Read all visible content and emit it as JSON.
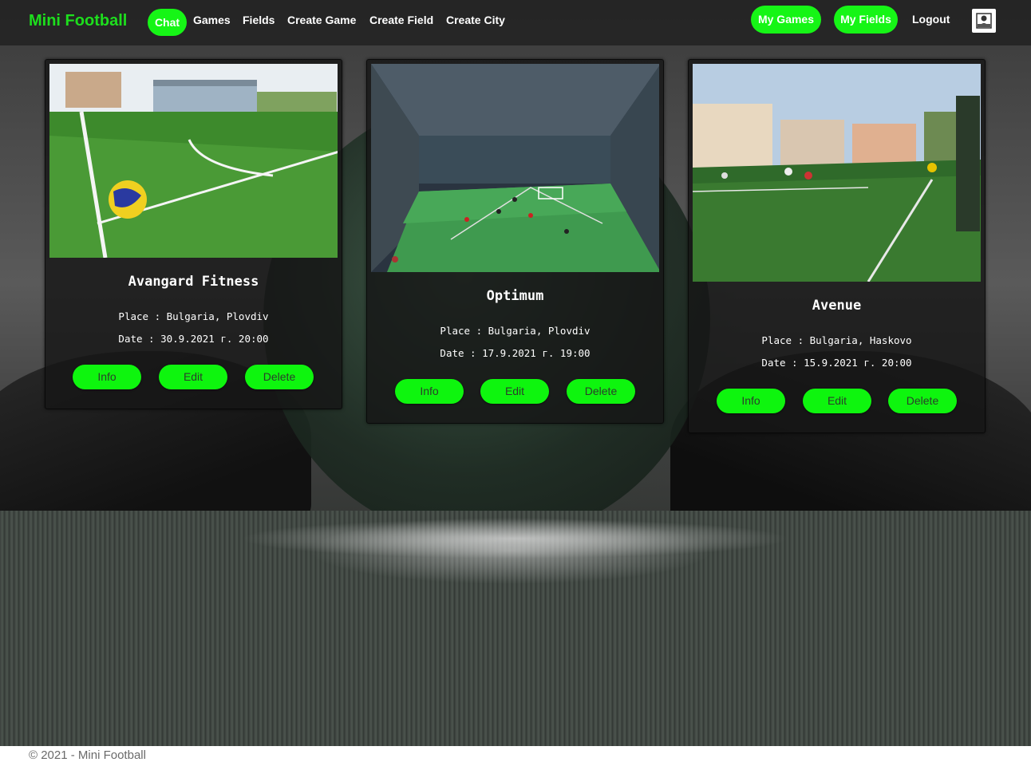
{
  "navbar": {
    "brand": "Mini Football",
    "links": {
      "chat": "Chat",
      "games": "Games",
      "fields": "Fields",
      "create_game": "Create Game",
      "create_field": "Create Field",
      "create_city": "Create City",
      "my_games": "My Games",
      "my_fields": "My Fields",
      "logout": "Logout"
    },
    "avatar_icon": "user-icon",
    "accent_color": "#16f516"
  },
  "cards": [
    {
      "title": "Avangard Fitness",
      "place": "Place : Bulgaria, Plovdiv",
      "date": "Date : 30.9.2021 г. 20:00",
      "buttons": {
        "info": "Info",
        "edit": "Edit",
        "delete": "Delete"
      }
    },
    {
      "title": "Optimum",
      "place": "Place : Bulgaria, Plovdiv",
      "date": "Date : 17.9.2021 г. 19:00",
      "buttons": {
        "info": "Info",
        "edit": "Edit",
        "delete": "Delete"
      }
    },
    {
      "title": "Avenue",
      "place": "Place : Bulgaria, Haskovo",
      "date": "Date : 15.9.2021 г. 20:00",
      "buttons": {
        "info": "Info",
        "edit": "Edit",
        "delete": "Delete"
      }
    }
  ],
  "footer": {
    "text": "© 2021 - Mini Football"
  }
}
